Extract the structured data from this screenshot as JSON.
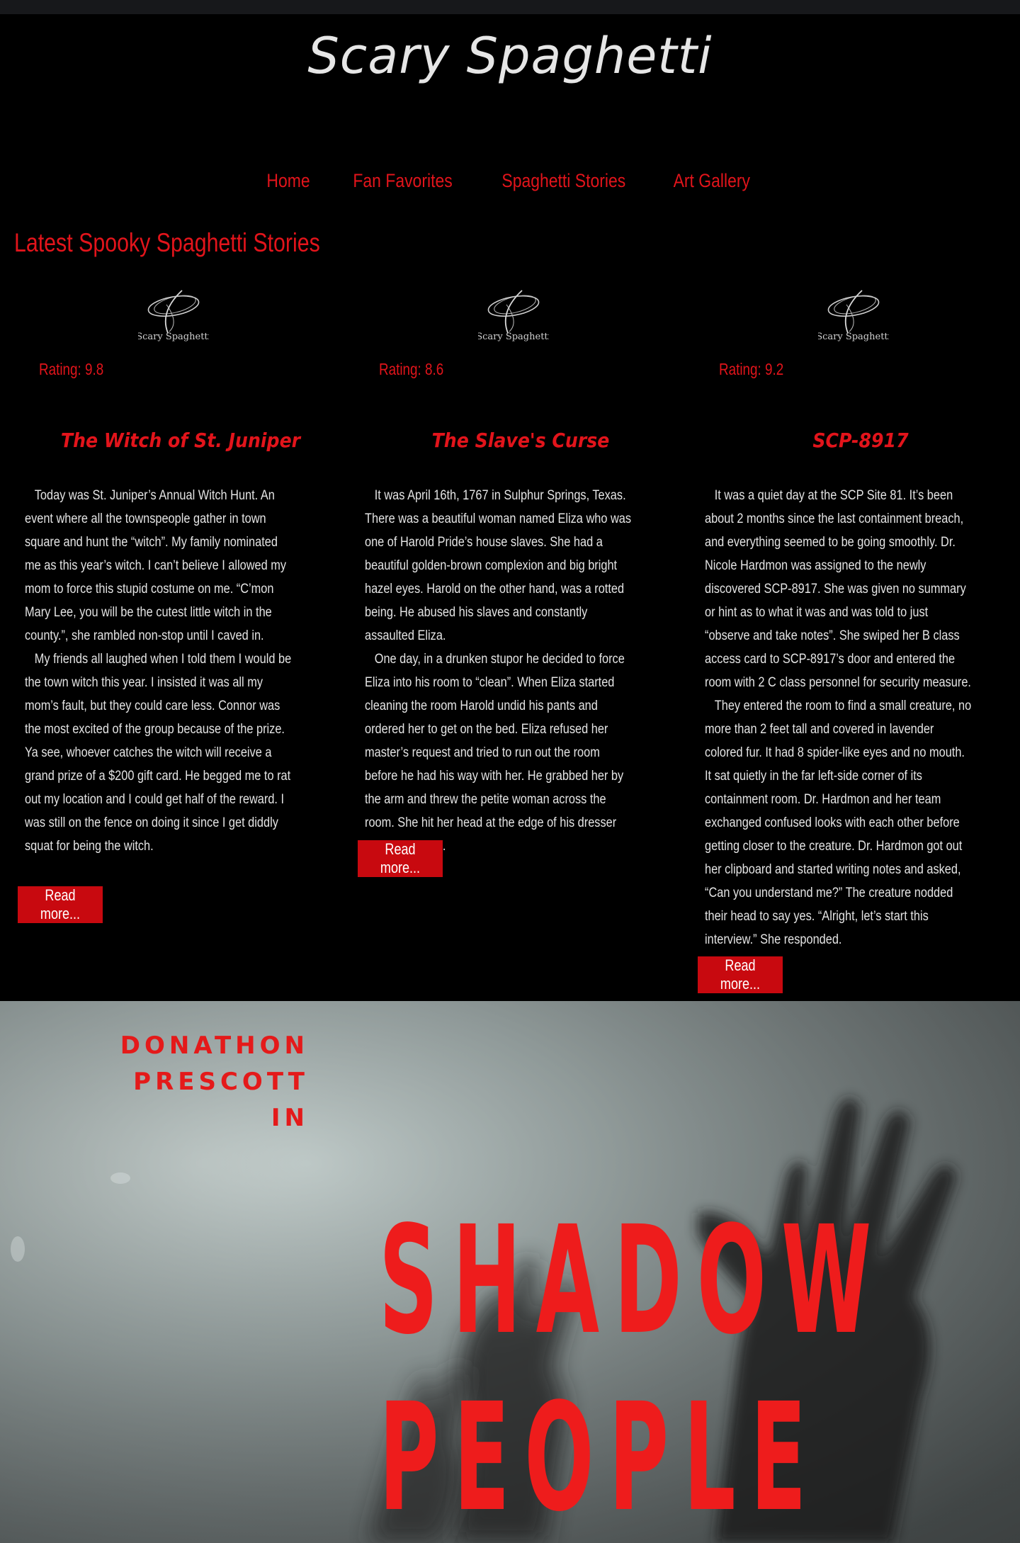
{
  "header": {
    "site_title": "Scary Spaghetti"
  },
  "nav": {
    "items": [
      "Home",
      "Fan Favorites",
      "Spaghetti Stories",
      "Art Gallery"
    ]
  },
  "main": {
    "heading": "Latest Spooky Spaghetti Stories",
    "logo_text": "Scary Spaghetti",
    "read_more_label": "Read more...",
    "stories": [
      {
        "rating": "Rating: 9.8",
        "title": "The Witch of St. Juniper",
        "paragraphs": [
          "Today was St. Juniper’s Annual Witch Hunt. An event where all the townspeople gather in town square and hunt the “witch”. My family nominated me as this year’s witch. I can’t believe I allowed my mom to force this stupid costume on me. “C’mon Mary Lee, you will be the cutest little witch in the county.”, she rambled non-stop until I caved in.",
          "My friends all laughed when I told them I would be the town witch this year. I insisted it was all my mom’s fault, but they could care less. Connor was the most excited of the group because of the prize. Ya see, whoever catches the witch will receive a grand prize of a $200 gift card. He begged me to rat out my location and I could get half of the reward. I was still on the fence on doing it since I get diddly squat for being the witch."
        ]
      },
      {
        "rating": "Rating: 8.6",
        "title": "The Slave's Curse",
        "paragraphs": [
          "It was April 16th, 1767 in Sulphur Springs, Texas. There was a beautiful woman named Eliza who was one of Harold Pride’s house slaves. She had a beautiful golden-brown complexion and big bright hazel eyes. Harold on the other hand, was a rotted being. He abused his slaves and constantly assaulted Eliza.",
          "One day, in a drunken stupor he decided to force Eliza into his room to “clean”. When Eliza started cleaning the room Harold undid his pants and ordered her to get on the bed. Eliza refused her master’s request and tried to run out the room before he had his way with her. He grabbed her by the arm and threw the petite woman across the room. She hit her head at the edge of his dresser and was dazed."
        ]
      },
      {
        "rating": "Rating: 9.2",
        "title": "SCP-8917",
        "paragraphs": [
          "It was a quiet day at the SCP Site 81. It’s been about 2 months since the last containment breach, and everything seemed to be going smoothly. Dr. Nicole Hardmon was assigned to the newly discovered SCP-8917. She was given no summary or hint as to what it was and was told to just “observe and take notes”. She swiped her B class access card to SCP-8917’s door and entered the room with 2 C class personnel for security measure.",
          "They entered the room to find a small creature, no more than 2 feet tall and covered in lavender colored fur. It had 8 spider-like eyes and no mouth. It sat quietly in the far left-side corner of its containment room. Dr. Hardmon and her team exchanged confused looks with each other before getting closer to the creature. Dr. Hardmon got out her clipboard and started writing notes and asked, “Can you understand me?” The creature nodded their head to say yes. “Alright, let’s start this interview.” She responded."
        ]
      }
    ]
  },
  "banner": {
    "author_lines": [
      "DONATHON",
      "PRESCOTT",
      "IN"
    ],
    "title_lines": [
      "SHADOW",
      "PEOPLE"
    ]
  },
  "colors": {
    "accent_red": "#e2141b",
    "button_red": "#c8090f",
    "background": "#000000"
  }
}
